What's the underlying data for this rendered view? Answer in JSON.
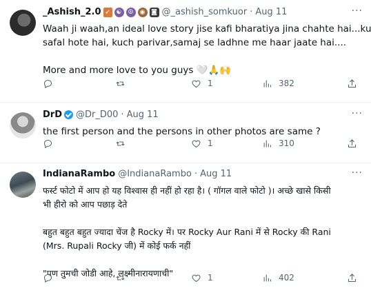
{
  "tweets": [
    {
      "name": "_Ashish_2.0",
      "badges": [
        "bow-arrow-emoji",
        "yin-yang-emoji",
        "peace-emoji",
        "owl-emoji",
        "camera-emoji"
      ],
      "handle": "@_ashish_somkuor",
      "dot": "·",
      "date": "Aug 11",
      "lines": [
        "Waah ji waah,an ideal love story jise kafi bharatiya jina chahte hai...kuch",
        "safal hote hai, kuch parivar,samaj se ladhne me haar jaate hai....",
        "",
        "More and more love to you guys 🤍🙏🙌"
      ],
      "replies": "",
      "retweets": "",
      "likes": "1",
      "views": "382"
    },
    {
      "name": "DrD",
      "verified": true,
      "handle": "@Dr_D00",
      "dot": "·",
      "date": "Aug 11",
      "lines": [
        "the first person and the persons in other photos are same ?"
      ],
      "replies": "",
      "retweets": "",
      "likes": "1",
      "views": "310"
    },
    {
      "name": "IndianaRambo",
      "handle": "@IndianaRambo",
      "dot": "·",
      "date": "Aug 11",
      "lines": [
        "फर्स्ट फोटो में आप हो यह विश्वास ही नहीं हो रहा है। ( गॉगल वाले फोटो )। अच्छे खासे किसी",
        "भी हीरो को आप पछाड़ देते",
        "",
        "बहुत बहुत बहुत ज्यादा चेंज है Rocky में। पर Rocky Aur Rani में से Rocky की Rani",
        "(Mrs. Rupali Rocky जी) में कोई फर्क नहीं",
        "",
        "\"पण तुमची जोडी आहे, लक्ष्मीनारायणाची\""
      ],
      "replies": "",
      "retweets": "",
      "likes": "1",
      "views": "402"
    }
  ],
  "more_icon": "more-dots-icon",
  "colors": {
    "text": "#0f1419",
    "muted": "#536471",
    "divider": "#eff3f4",
    "verified": "#1d9bf0"
  }
}
